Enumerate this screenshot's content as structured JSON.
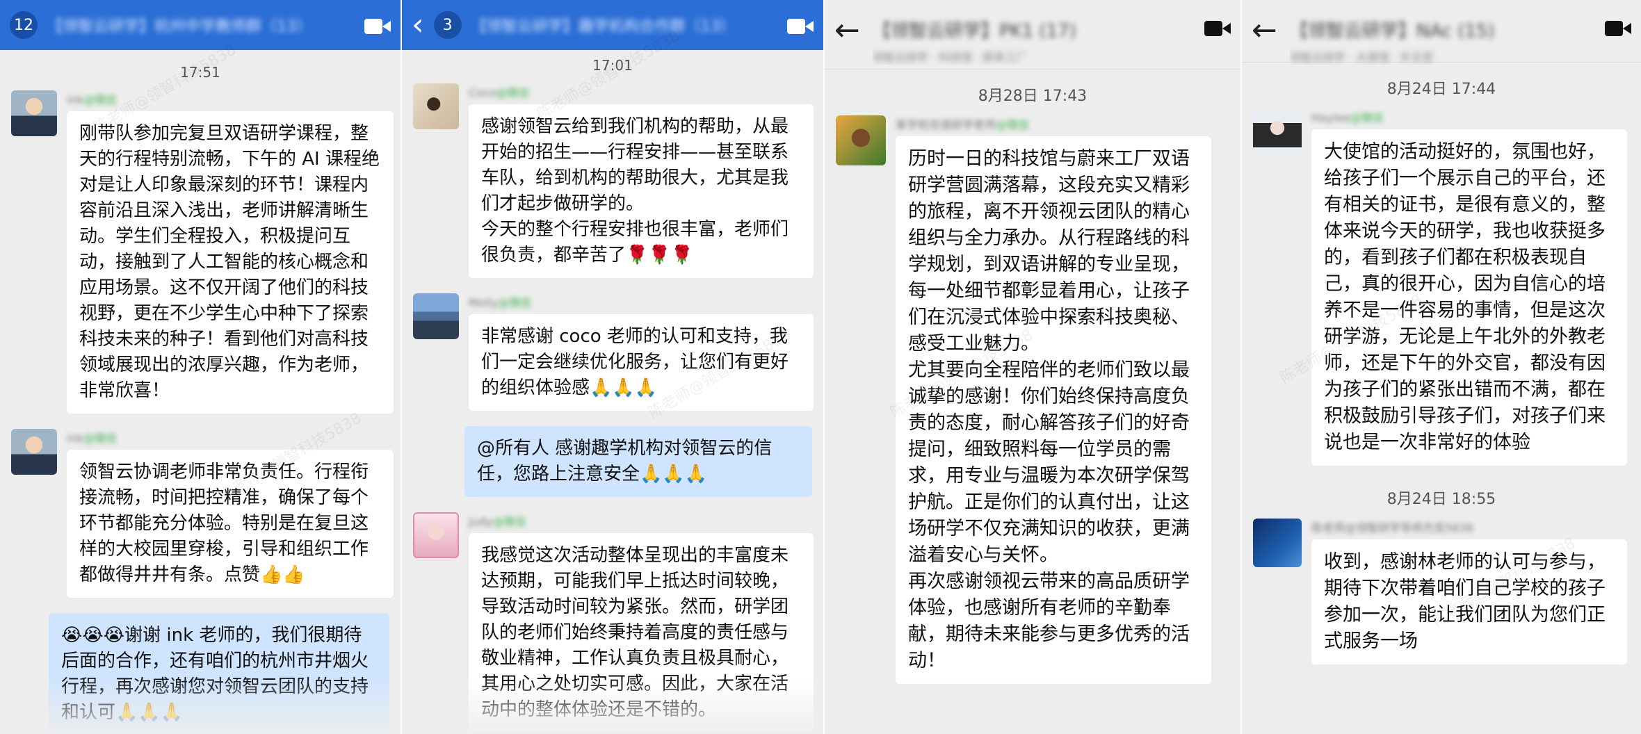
{
  "panels": [
    {
      "badge": "12",
      "title": "【领智云研学】杭州中学教师群（13）",
      "time": "17:51",
      "messages": [
        {
          "sender": "ink",
          "tag": "@微信",
          "text": "刚带队参加完复旦双语研学课程，整天的行程特别流畅，下午的 AI 课程绝对是让人印象最深刻的环节！课程内容前沿且深入浅出，老师讲解清晰生动。学生们全程投入，积极提问互动，接触到了人工智能的核心概念和应用场景。这不仅开阔了他们的科技视野，更在不少学生心中种下了探索科技未来的种子！看到他们对高科技领域展现出的浓厚兴趣，作为老师，非常欣喜！"
        },
        {
          "sender": "ink",
          "tag": "@微信",
          "text": "领智云协调老师非常负责任。行程衔接流畅，时间把控精准，确保了每个环节都能充分体验。特别是在复旦这样的大校园里穿梭，引导和组织工作都做得井井有条。点赞👍👍"
        },
        {
          "sender": "",
          "text": "😭😭😭谢谢 ink 老师的，我们很期待后面的合作，还有咱们的杭州市井烟火行程，再次感谢您对领智云团队的支持和认可🙏🙏🙏"
        }
      ]
    },
    {
      "badge": "3",
      "title": "【领智云研学】趣学机构合作群（13）",
      "time": "17:01",
      "messages": [
        {
          "sender": "Coco",
          "tag": "@微信",
          "text": "感谢领智云给到我们机构的帮助，从最开始的招生——行程安排——甚至联系车队，给到机构的帮助很大，尤其是我们才起步做研学的。\n今天的整个行程安排也很丰富，老师们很负责，都辛苦了🌹🌹🌹"
        },
        {
          "sender": "Molly",
          "tag": "@微信",
          "text": "非常感谢 coco 老师的认可和支持，我们一定会继续优化服务，让您们有更好的组织体验感🙏🙏🙏"
        },
        {
          "sender": "",
          "text": "@所有人 感谢趣学机构对领智云的信任，您路上注意安全🙏🙏🙏"
        },
        {
          "sender": "Judy",
          "tag": "@微信",
          "text": "我感觉这次活动整体呈现出的丰富度未达预期，可能我们早上抵达时间较晚，导致活动时间较为紧张。然而，研学团队的老师们始终秉持着高度的责任感与敬业精神，工作认真负责且极具耐心，其用心之处切实可感。因此，大家在活动中的整体体验还是不错的。"
        }
      ]
    },
    {
      "title": "【领智云研学】PK1 (17)",
      "subtitle": "领智云研学 · 科技馆 · 蔚来工厂",
      "time": "8月28日  17:43",
      "messages": [
        {
          "sender": "某学校双语研学老师",
          "tag": "@微信",
          "text": "历时一日的科技馆与蔚来工厂双语研学营圆满落幕，这段充实又精彩的旅程，离不开领视云团队的精心组织与全力承办。从行程路线的科学规划，到双语讲解的专业呈现，每一处细节都彰显着用心，让孩子们在沉浸式体验中探索科技奥秘、感受工业魅力。\n尤其要向全程陪伴的老师们致以最诚挚的感谢！你们始终保持高度负责的态度，耐心解答孩子们的好奇提问，细致照料每一位学员的需求，用专业与温暖为本次研学保驾护航。正是你们的认真付出，让这场研学不仅充满知识的收获，更满溢着安心与关怀。\n再次感谢领视云带来的高品质研学体验，也感谢所有老师的辛勤奉献，期待未来能参与更多优秀的活动！"
        }
      ]
    },
    {
      "title": "【领智云研学】NAc (15)",
      "subtitle": "领智云研学 · 大使馆 · 外交官",
      "time1": "8月24日  17:44",
      "time2": "8月24日  18:55",
      "messages": [
        {
          "sender": "Haylee",
          "tag": "@微信",
          "text": "大使馆的活动挺好的，氛围也好，给孩子们一个展示自己的平台，还有相关的证书，是很有意义的，整体来说今天的研学，我也收获挺多的，看到孩子们都在积极表现自己，真的很开心，因为自信心的培养不是一件容易的事情，但是这次研学游，无论是上午北外的外教老师，还是下午的外交官，都没有因为孩子们的紧张出错而不满，都在积极鼓励引导孩子们，对孩子们来说也是一次非常好的体验"
        },
        {
          "sender": "陈老师@领智研学导师杰克5838",
          "tag": "",
          "text": "收到，感谢林老师的认可与参与，期待下次带着咱们自己学校的孩子参加一次，能让我们团队为您们正式服务一场"
        }
      ]
    }
  ],
  "watermark": "陈老师@领智科技5838",
  "colors": {
    "bubble_white": "#ffffff",
    "bubble_blue": "#cfe4ff",
    "header_blue": "#2b6ed6",
    "chat_bg": "#ededed",
    "tag_green": "#3fb24f"
  },
  "icons": [
    "video-call-icon",
    "back-chevron-icon",
    "back-arrow-icon"
  ]
}
